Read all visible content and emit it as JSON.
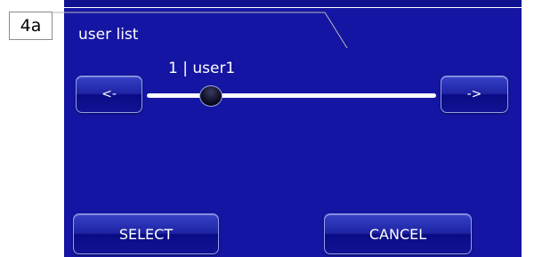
{
  "callout": {
    "label": "4a"
  },
  "screen": {
    "title": "user list",
    "user_readout": "1 | user1",
    "slider": {
      "value": 1
    },
    "buttons": {
      "prev": "<-",
      "next": "->",
      "select": "SELECT",
      "cancel": "CANCEL"
    }
  },
  "colors": {
    "screen_background": "#1515a3",
    "button_border": "#8fa0e8",
    "text": "#ffffff"
  }
}
